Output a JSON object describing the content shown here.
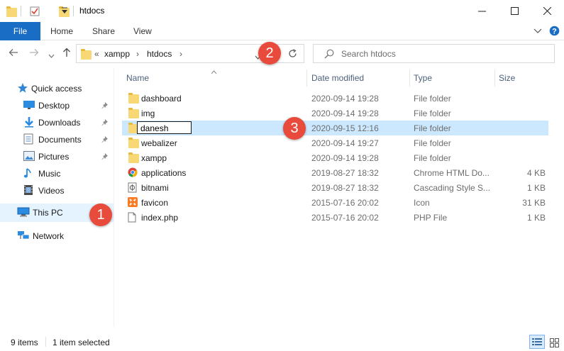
{
  "window": {
    "title": "htdocs"
  },
  "ribbon": {
    "tabs": [
      "File",
      "Home",
      "Share",
      "View"
    ]
  },
  "address": {
    "path": [
      "xampp",
      "htdocs"
    ],
    "overflow": "«"
  },
  "search": {
    "placeholder": "Search htdocs"
  },
  "sidebar": {
    "quick_access": "Quick access",
    "items": [
      {
        "label": "Desktop",
        "pinned": true,
        "icon": "desktop-icon"
      },
      {
        "label": "Downloads",
        "pinned": true,
        "icon": "download-icon"
      },
      {
        "label": "Documents",
        "pinned": true,
        "icon": "document-icon"
      },
      {
        "label": "Pictures",
        "pinned": true,
        "icon": "picture-icon"
      },
      {
        "label": "Music",
        "pinned": false,
        "icon": "music-icon"
      },
      {
        "label": "Videos",
        "pinned": false,
        "icon": "video-icon"
      }
    ],
    "this_pc": "This PC",
    "network": "Network"
  },
  "columns": {
    "name": "Name",
    "date": "Date modified",
    "type": "Type",
    "size": "Size"
  },
  "files": [
    {
      "name": "dashboard",
      "date": "2020-09-14 19:28",
      "type": "File folder",
      "size": "",
      "icon": "folder-icon"
    },
    {
      "name": "img",
      "date": "2020-09-14 19:28",
      "type": "File folder",
      "size": "",
      "icon": "folder-icon"
    },
    {
      "name": "danesh",
      "date": "2020-09-15 12:16",
      "type": "File folder",
      "size": "",
      "icon": "folder-icon",
      "selected": true,
      "renaming": true
    },
    {
      "name": "webalizer",
      "date": "2020-09-14 19:27",
      "type": "File folder",
      "size": "",
      "icon": "folder-icon"
    },
    {
      "name": "xampp",
      "date": "2020-09-14 19:28",
      "type": "File folder",
      "size": "",
      "icon": "folder-icon"
    },
    {
      "name": "applications",
      "date": "2019-08-27 18:32",
      "type": "Chrome HTML Do...",
      "size": "4 KB",
      "icon": "chrome-icon"
    },
    {
      "name": "bitnami",
      "date": "2019-08-27 18:32",
      "type": "Cascading Style S...",
      "size": "1 KB",
      "icon": "css-file-icon"
    },
    {
      "name": "favicon",
      "date": "2015-07-16 20:02",
      "type": "Icon",
      "size": "31 KB",
      "icon": "xampp-icon"
    },
    {
      "name": "index.php",
      "date": "2015-07-16 20:02",
      "type": "PHP File",
      "size": "1 KB",
      "icon": "file-icon"
    }
  ],
  "status": {
    "count": "9 items",
    "selected": "1 item selected"
  },
  "annotations": [
    "1",
    "2",
    "3"
  ],
  "colors": {
    "accent": "#1a6dc4",
    "selection": "#cce8ff",
    "badge": "#e84a3c",
    "folder": "#f8d775"
  }
}
